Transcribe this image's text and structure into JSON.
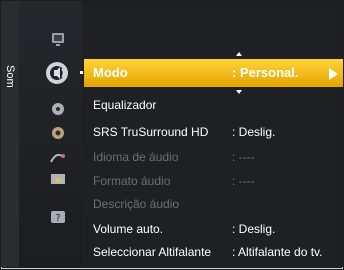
{
  "menu": {
    "section_label": "Som",
    "selected": {
      "label": "Modo",
      "value": ": Personal."
    },
    "items": [
      {
        "label": "Equalizador",
        "value": ""
      },
      {
        "label": "SRS TruSurround HD",
        "value": ": Deslig."
      },
      {
        "label": "Idioma de áudio",
        "value": ": ----"
      },
      {
        "label": "Formato áudio",
        "value": ": ----"
      },
      {
        "label": "Descrição áudio",
        "value": ""
      },
      {
        "label": "Volume auto.",
        "value": ": Deslig."
      },
      {
        "label": "Seleccionar Altifalante",
        "value": ": Altifalante do tv."
      }
    ]
  },
  "icons": [
    {
      "name": "picture-icon"
    },
    {
      "name": "sound-icon"
    },
    {
      "name": "channel-icon"
    },
    {
      "name": "setup-icon"
    },
    {
      "name": "input-icon"
    },
    {
      "name": "application-icon"
    },
    {
      "name": "support-icon"
    }
  ],
  "colors": {
    "highlight": "#f2b705",
    "disabled_text": "#6c6f74",
    "background": "#1e2024"
  }
}
